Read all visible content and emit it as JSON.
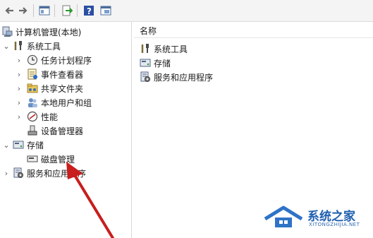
{
  "toolbar": {
    "buttons": [
      "back-icon",
      "forward-icon",
      "show-tree-icon",
      "export-icon",
      "help-icon",
      "properties-icon"
    ]
  },
  "tree": {
    "root_label": "计算机管理(本地)",
    "system_tools": "系统工具",
    "task_scheduler": "任务计划程序",
    "event_viewer": "事件查看器",
    "shared_folders": "共享文件夹",
    "local_users": "本地用户和组",
    "performance": "性能",
    "device_manager": "设备管理器",
    "storage": "存储",
    "disk_management": "磁盘管理",
    "services_apps": "服务和应用程序"
  },
  "list": {
    "column_name": "名称",
    "items": [
      "系统工具",
      "存储",
      "服务和应用程序"
    ]
  },
  "watermark": {
    "text": "系统之家",
    "sub": "XITONGZHIJIA.NET"
  },
  "colors": {
    "arrow": "#c81e1e",
    "selection": "#cce8ff",
    "watermark": "#1f5fb0"
  }
}
